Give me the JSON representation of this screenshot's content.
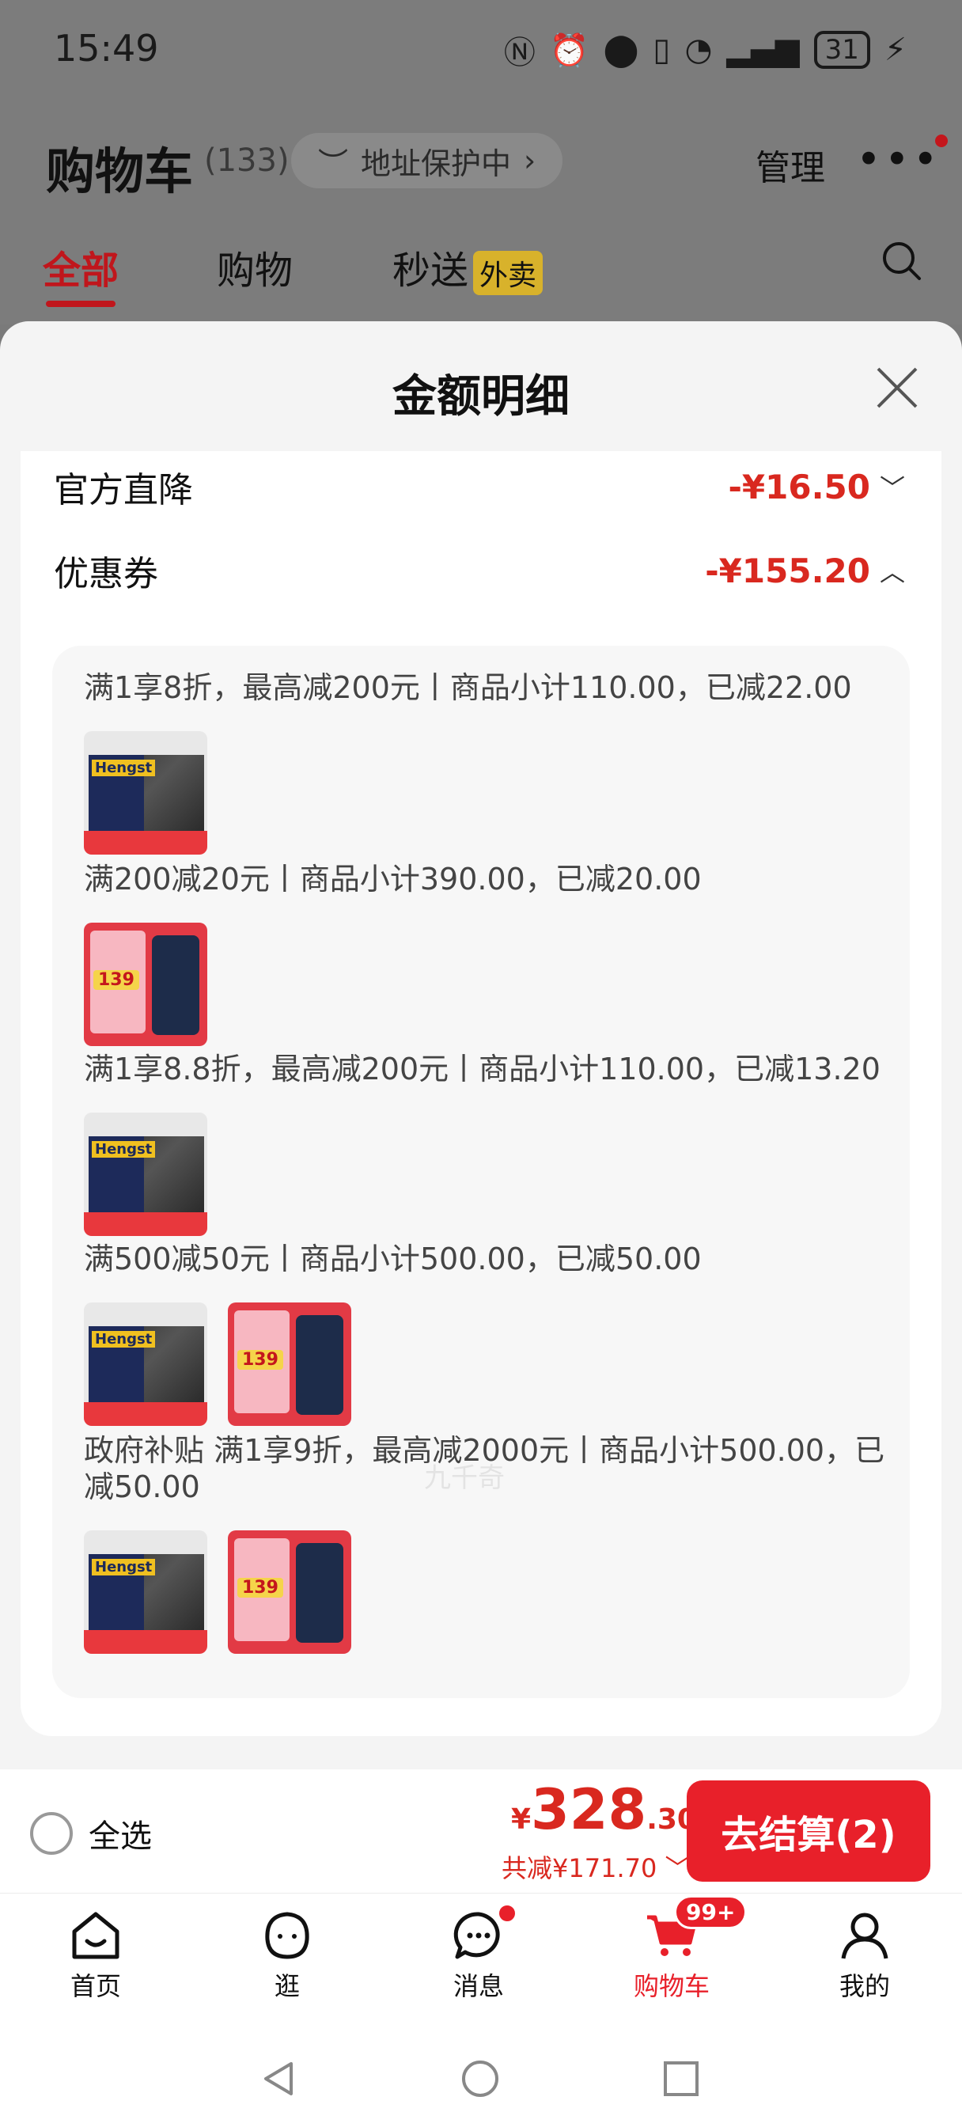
{
  "status": {
    "time": "15:49",
    "battery": "31"
  },
  "header": {
    "title": "购物车",
    "count": "(133)",
    "address_tag": "地址保护中",
    "manage": "管理",
    "tabs": [
      {
        "label": "全部"
      },
      {
        "label": "购物"
      },
      {
        "label": "秒送"
      }
    ],
    "waimai": "外卖"
  },
  "sheet": {
    "title": "金额明细",
    "official_label": "官方直降",
    "official_value": "-¥16.50",
    "coupon_label": "优惠券",
    "coupon_value": "-¥155.20",
    "coupon_lines": [
      "满1享8折，最高减200元丨商品小计110.00，已减22.00",
      "满200减20元丨商品小计390.00，已减20.00",
      "满1享8.8折，最高减200元丨商品小计110.00，已减13.20",
      "满500减50元丨商品小计500.00，已减50.00",
      "政府补贴 满1享9折，最高减2000元丨商品小计500.00，已减50.00"
    ],
    "watermark": "九千奇"
  },
  "checkout": {
    "select_all": "全选",
    "currency": "¥",
    "price_int": "328",
    "price_dec": ".30",
    "saved": "共减¥171.70",
    "pay": "去结算(2)"
  },
  "tabbar": {
    "items": [
      {
        "label": "首页"
      },
      {
        "label": "逛"
      },
      {
        "label": "消息"
      },
      {
        "label": "购物车"
      },
      {
        "label": "我的"
      }
    ],
    "cart_badge": "99+"
  },
  "colors": {
    "accent": "#e8202a",
    "price_red": "#d9281f"
  }
}
